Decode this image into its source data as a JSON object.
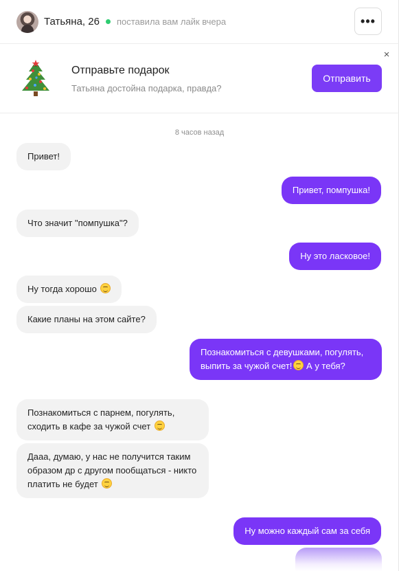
{
  "header": {
    "user_name": "Татьяна, 26",
    "status": "поставила вам лайк вчера",
    "more_label": "•••"
  },
  "gift": {
    "title": "Отправьте подарок",
    "subtitle": "Татьяна достойна подарка, правда?",
    "send_label": "Отправить",
    "close_label": "×"
  },
  "chat": {
    "timestamp": "8 часов назад",
    "messages": [
      {
        "from": "in",
        "text": "Привет!"
      },
      {
        "from": "out",
        "text": "Привет, помпушка!"
      },
      {
        "from": "in",
        "text": "Что значит \"помпушка\"?"
      },
      {
        "from": "out",
        "text": "Ну это ласковое!"
      },
      {
        "from": "in",
        "text": "Ну тогда хорошо"
      },
      {
        "from": "in",
        "text": "Какие планы на этом сайте?"
      },
      {
        "from": "out",
        "text_a": "Познакомиться с девушками, погулять, выпить за чужой счет!",
        "text_b": "А у тебя?"
      },
      {
        "from": "in",
        "text": "Познакомиться с парнем, погулять, сходить в кафе за чужой счет"
      },
      {
        "from": "in",
        "text": "Дааа, думаю, у нас не получится таким образом др с другом пообщаться - никто платить не будет"
      },
      {
        "from": "out",
        "text": "Ну можно каждый сам за себя"
      }
    ]
  },
  "colors": {
    "accent": "#7b3cf6",
    "incoming_bubble": "#f2f2f2",
    "online": "#2ecc71"
  }
}
